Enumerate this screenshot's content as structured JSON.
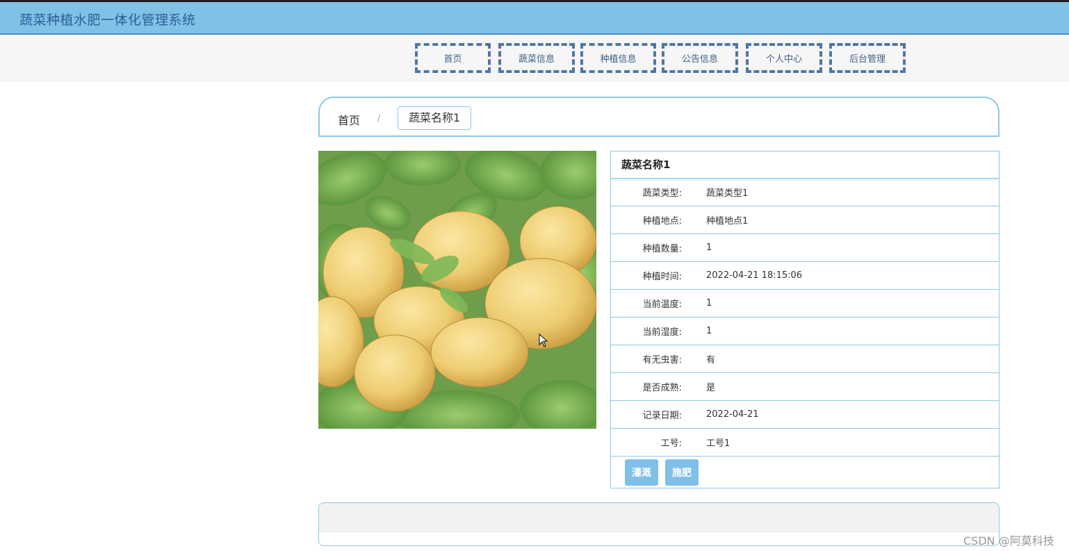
{
  "header": {
    "title": "蔬菜种植水肥一体化管理系统"
  },
  "nav": {
    "items": [
      {
        "label": "首页"
      },
      {
        "label": "蔬菜信息"
      },
      {
        "label": "种植信息"
      },
      {
        "label": "公告信息"
      },
      {
        "label": "个人中心"
      },
      {
        "label": "后台管理"
      }
    ]
  },
  "breadcrumb": {
    "home": "首页",
    "separator": "/",
    "current": "蔬菜名称1"
  },
  "detail": {
    "title": "蔬菜名称1",
    "rows": [
      {
        "label": "蔬菜类型:",
        "value": "蔬菜类型1"
      },
      {
        "label": "种植地点:",
        "value": "种植地点1"
      },
      {
        "label": "种植数量:",
        "value": "1"
      },
      {
        "label": "种植时间:",
        "value": "2022-04-21 18:15:06"
      },
      {
        "label": "当前温度:",
        "value": "1"
      },
      {
        "label": "当前湿度:",
        "value": "1"
      },
      {
        "label": "有无虫害:",
        "value": "有"
      },
      {
        "label": "是否成熟:",
        "value": "是"
      },
      {
        "label": "记录日期:",
        "value": "2022-04-21"
      },
      {
        "label": "工号:",
        "value": "工号1"
      }
    ],
    "buttons": {
      "irrigate": "灌溉",
      "fertilize": "施肥"
    }
  },
  "watermark": "CSDN @阿莫科技",
  "colors": {
    "header_bg": "#80c1e6",
    "accent": "#8ec8e4",
    "button": "#7fbfe8",
    "nav_border": "#4e76a6"
  }
}
